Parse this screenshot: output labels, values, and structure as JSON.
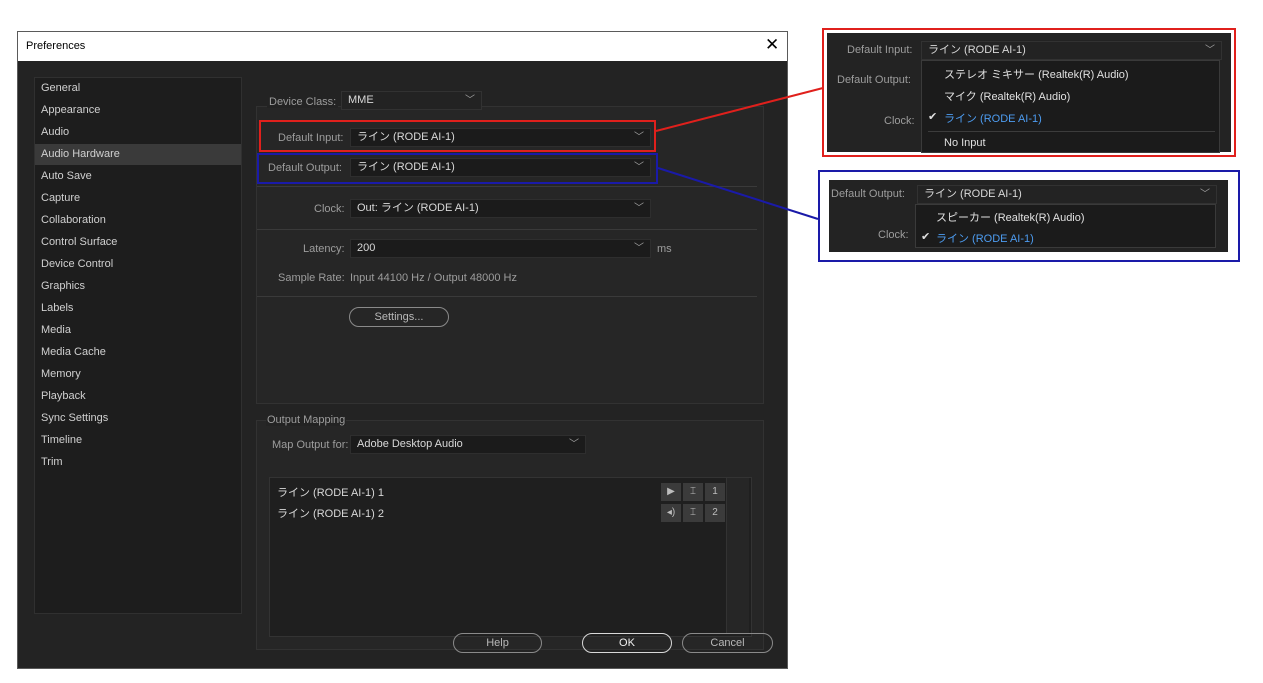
{
  "dialog": {
    "title": "Preferences",
    "close_icon": "✕"
  },
  "sidebar": {
    "items": [
      {
        "label": "General"
      },
      {
        "label": "Appearance"
      },
      {
        "label": "Audio"
      },
      {
        "label": "Audio Hardware"
      },
      {
        "label": "Auto Save"
      },
      {
        "label": "Capture"
      },
      {
        "label": "Collaboration"
      },
      {
        "label": "Control Surface"
      },
      {
        "label": "Device Control"
      },
      {
        "label": "Graphics"
      },
      {
        "label": "Labels"
      },
      {
        "label": "Media"
      },
      {
        "label": "Media Cache"
      },
      {
        "label": "Memory"
      },
      {
        "label": "Playback"
      },
      {
        "label": "Sync Settings"
      },
      {
        "label": "Timeline"
      },
      {
        "label": "Trim"
      }
    ],
    "selected": "Audio Hardware"
  },
  "hardware": {
    "device_class_label": "Device Class:",
    "device_class_value": "MME",
    "default_input_label": "Default Input:",
    "default_input_value": "ライン (RODE AI-1)",
    "default_output_label": "Default Output:",
    "default_output_value": "ライン (RODE AI-1)",
    "clock_label": "Clock:",
    "clock_value": "Out: ライン (RODE AI-1)",
    "latency_label": "Latency:",
    "latency_value": "200",
    "latency_unit": "ms",
    "sample_rate_label": "Sample Rate:",
    "sample_rate_value": "Input 44100 Hz / Output 48000 Hz",
    "settings_button": "Settings..."
  },
  "output_mapping": {
    "heading": "Output Mapping",
    "map_output_label": "Map Output for:",
    "map_output_value": "Adobe Desktop Audio",
    "channels": [
      {
        "name": "ライン (RODE AI-1) 1",
        "number": "1",
        "icon": "speaker-icon"
      },
      {
        "name": "ライン (RODE AI-1) 2",
        "number": "2",
        "icon": "speaker-icon"
      }
    ]
  },
  "footer": {
    "help": "Help",
    "ok": "OK",
    "cancel": "Cancel"
  },
  "zoom_input": {
    "label": "Default Input:",
    "value": "ライン (RODE AI-1)",
    "output_label": "Default Output:",
    "clock_label": "Clock:",
    "options": [
      "ステレオ ミキサー (Realtek(R) Audio)",
      "マイク (Realtek(R) Audio)",
      "ライン (RODE AI-1)",
      "No Input"
    ],
    "checked": "ライン (RODE AI-1)",
    "highlight_color": "#e0201c"
  },
  "zoom_output": {
    "label": "Default Output:",
    "value": "ライン (RODE AI-1)",
    "clock_label": "Clock:",
    "options": [
      "スピーカー (Realtek(R) Audio)",
      "ライン (RODE AI-1)"
    ],
    "checked": "ライン (RODE AI-1)",
    "highlight_color": "#1a1aa8"
  },
  "colors": {
    "selected_option": "#4d9cf0",
    "red_highlight": "#e0201c",
    "blue_highlight": "#1a1aa8"
  }
}
